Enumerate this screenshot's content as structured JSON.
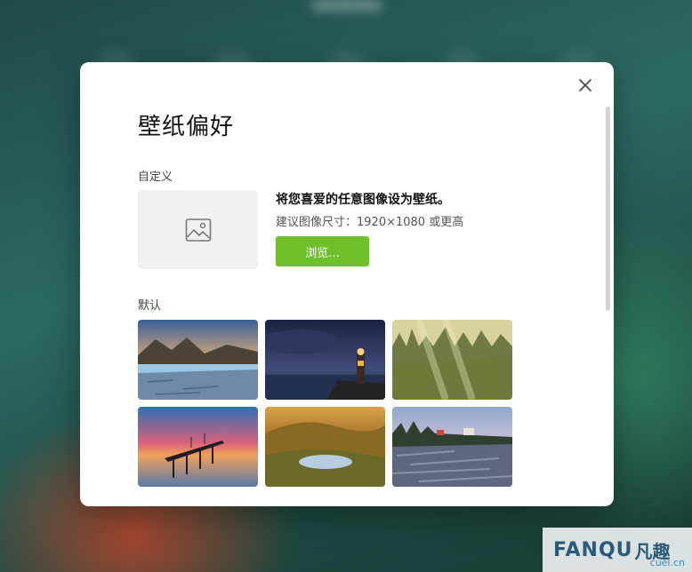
{
  "dialog": {
    "title": "壁纸偏好",
    "close_icon": "close-icon"
  },
  "custom": {
    "section_label": "自定义",
    "heading": "将您喜爱的任意图像设为壁纸。",
    "hint": "建议图像尺寸：1920×1080 或更高",
    "browse_label": "浏览...",
    "preview_icon": "image-placeholder-icon"
  },
  "defaults": {
    "section_label": "默认",
    "wallpapers": [
      {
        "name": "wallpaper-mountain-lake"
      },
      {
        "name": "wallpaper-lighthouse"
      },
      {
        "name": "wallpaper-misty-forest"
      },
      {
        "name": "wallpaper-sunset-pier"
      },
      {
        "name": "wallpaper-autumn-valley"
      },
      {
        "name": "wallpaper-rocky-coast"
      }
    ]
  },
  "colors": {
    "accent": "#6ec02a"
  },
  "watermark": {
    "brand": "FANQU",
    "brand_cn": "凡趣",
    "domain": "cuel.cn"
  }
}
